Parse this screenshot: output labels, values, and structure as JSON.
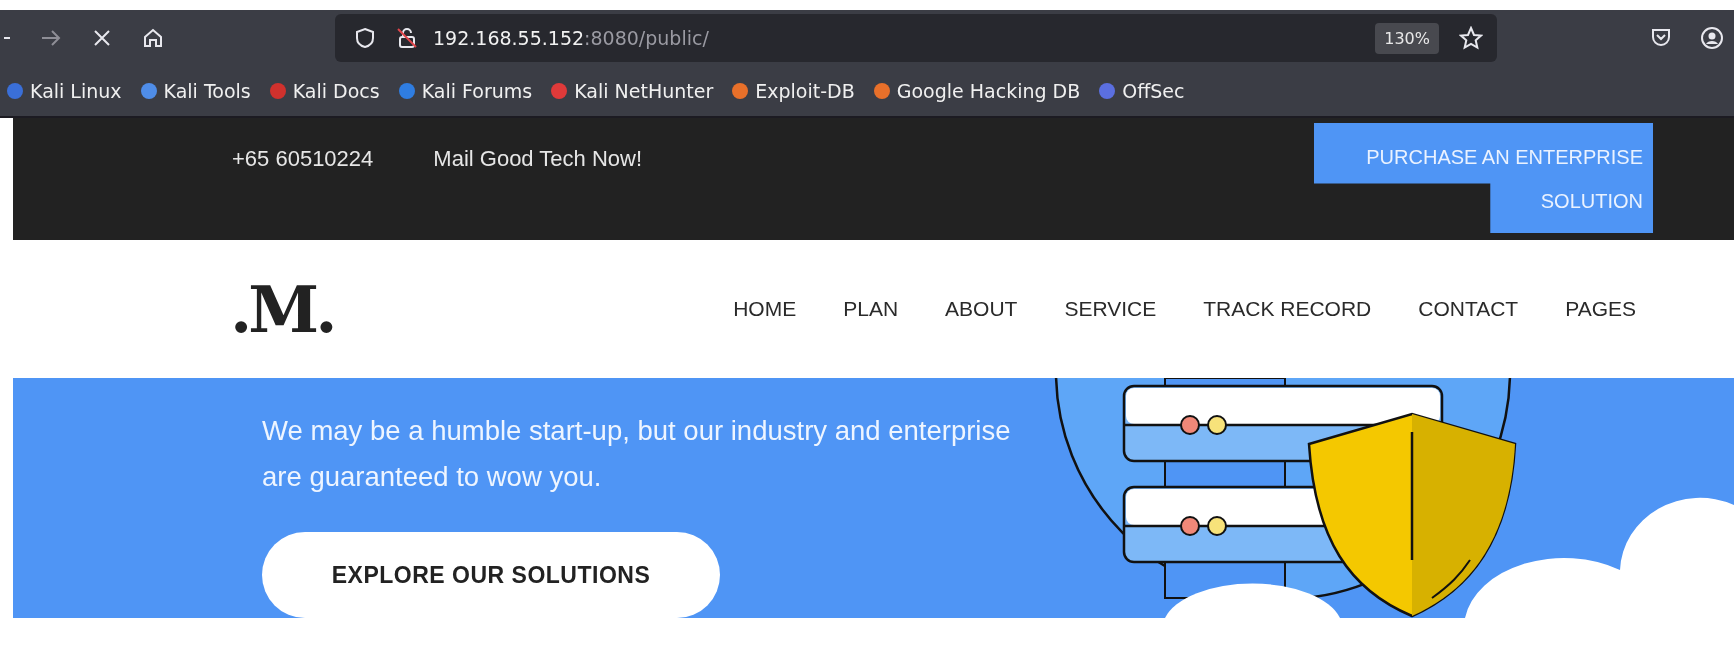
{
  "browser": {
    "url_host": "192.168.55.152",
    "url_rest": ":8080/public/",
    "zoom": "130%",
    "bookmarks": [
      {
        "label": "Kali Linux",
        "color": "#3a6fd8"
      },
      {
        "label": "Kali Tools",
        "color": "#4f8de8"
      },
      {
        "label": "Kali Docs",
        "color": "#d0312d"
      },
      {
        "label": "Kali Forums",
        "color": "#2f7de1"
      },
      {
        "label": "Kali NetHunter",
        "color": "#e03a3a"
      },
      {
        "label": "Exploit-DB",
        "color": "#e8702a"
      },
      {
        "label": "Google Hacking DB",
        "color": "#e8702a"
      },
      {
        "label": "OffSec",
        "color": "#5b6fe0"
      }
    ]
  },
  "topbar": {
    "phone": "+65 60510224",
    "mail": "Mail Good Tech Now!",
    "cta": "PURCHASE AN ENTERPRISE SOLUTION"
  },
  "nav": {
    "logo": ".M.",
    "items": [
      "HOME",
      "PLAN",
      "ABOUT",
      "SERVICE",
      "TRACK RECORD",
      "CONTACT",
      "PAGES"
    ]
  },
  "hero": {
    "text": "We may be a humble start-up, but our industry and enterprise are guaranteed to wow you.",
    "button": "EXPLORE OUR SOLUTIONS"
  }
}
